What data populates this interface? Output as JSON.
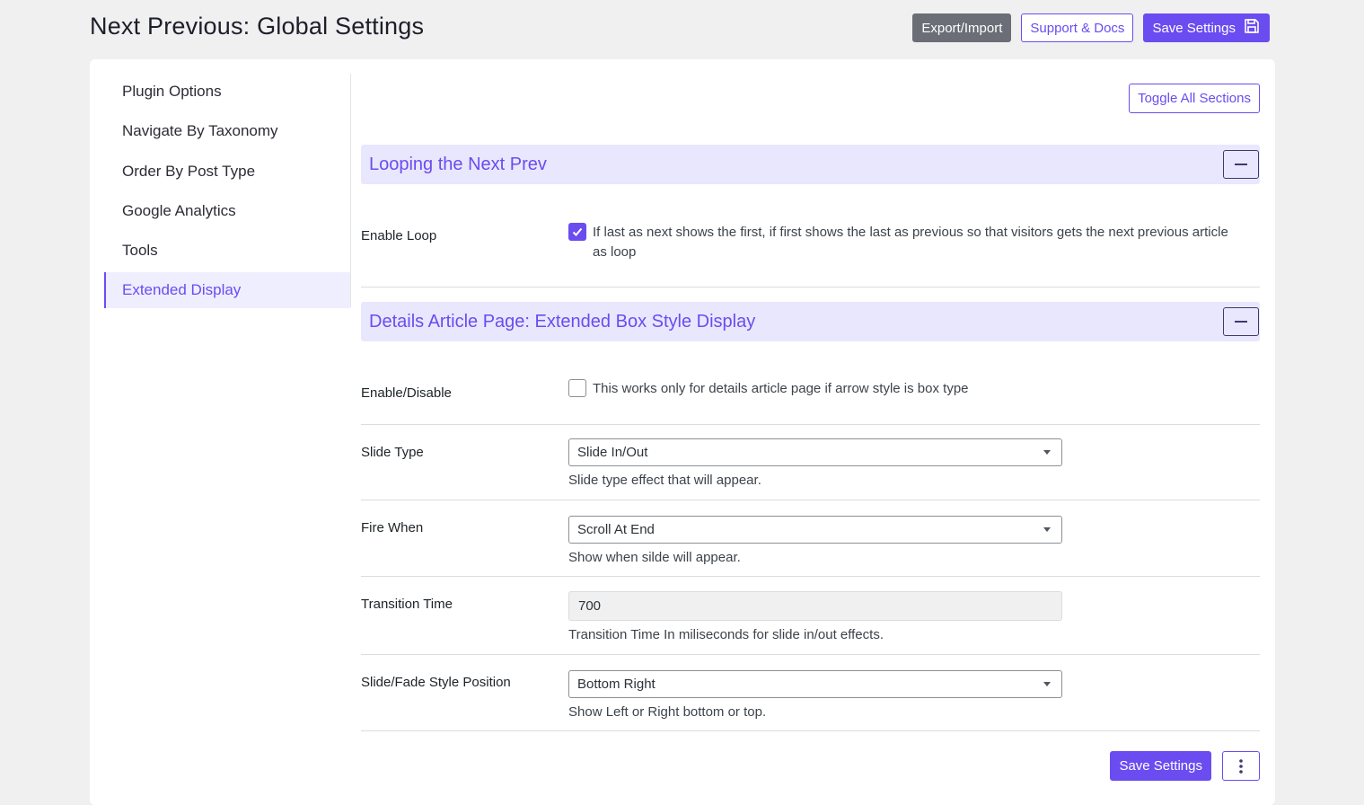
{
  "page": {
    "title": "Next Previous: Global Settings"
  },
  "header_actions": {
    "export_import": "Export/Import",
    "support_docs": "Support & Docs",
    "save_settings": "Save Settings"
  },
  "sidebar": {
    "items": [
      {
        "label": "Plugin Options"
      },
      {
        "label": "Navigate By Taxonomy"
      },
      {
        "label": "Order By Post Type"
      },
      {
        "label": "Google Analytics"
      },
      {
        "label": "Tools"
      },
      {
        "label": "Extended Display",
        "active": true
      }
    ]
  },
  "toggle_all_label": "Toggle All Sections",
  "sections": {
    "looping": {
      "title": "Looping the Next Prev",
      "enable_loop": {
        "label": "Enable Loop",
        "checked": true,
        "text": "If last as next shows the first, if first shows the last as previous so that visitors gets the next previous article as loop"
      }
    },
    "extended": {
      "title": "Details Article Page: Extended Box Style Display",
      "enable_disable": {
        "label": "Enable/Disable",
        "checked": false,
        "text": "This works only for details article page if arrow style is box type"
      },
      "slide_type": {
        "label": "Slide Type",
        "value": "Slide In/Out",
        "description": "Slide type effect that will appear."
      },
      "fire_when": {
        "label": "Fire When",
        "value": "Scroll At End",
        "description": "Show when silde will appear."
      },
      "transition_time": {
        "label": "Transition Time",
        "value": "700",
        "description": "Transition Time In miliseconds for slide in/out effects."
      },
      "position": {
        "label": "Slide/Fade Style Position",
        "value": "Bottom Right",
        "description": "Show Left or Right bottom or top."
      }
    }
  },
  "footer_actions": {
    "save_settings": "Save Settings"
  },
  "colors": {
    "accent": "#6a4cf0",
    "section_bg": "#e9e7fd",
    "page_bg": "#f0f0f1"
  },
  "icons": {
    "save": "floppy-disk-icon",
    "collapse": "minus-icon",
    "more": "vertical-dots-icon"
  }
}
